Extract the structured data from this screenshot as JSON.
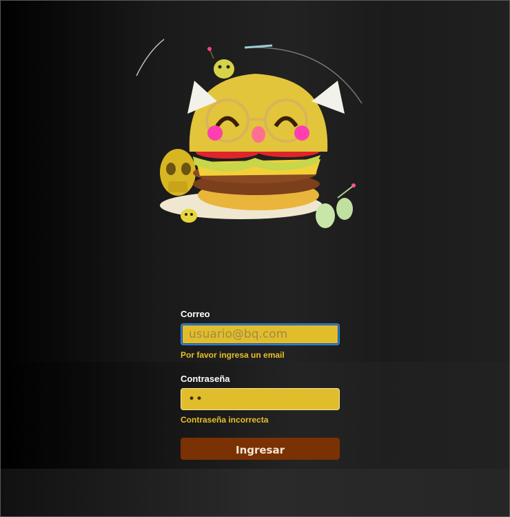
{
  "login": {
    "email_label": "Correo",
    "email_placeholder": "usuario@bq.com",
    "email_value": "",
    "email_error": "Por favor ingresa un email",
    "password_label": "Contraseña",
    "password_value": "••",
    "password_error": "Contraseña incorrecta",
    "submit_label": "Ingresar"
  },
  "colors": {
    "input_bg": "#e2bd2b",
    "error_text": "#e8c028",
    "button_bg": "#7a3103",
    "focus_ring": "#2d7fd6"
  },
  "icons": {
    "mascot": "burger-mascot-icon"
  }
}
